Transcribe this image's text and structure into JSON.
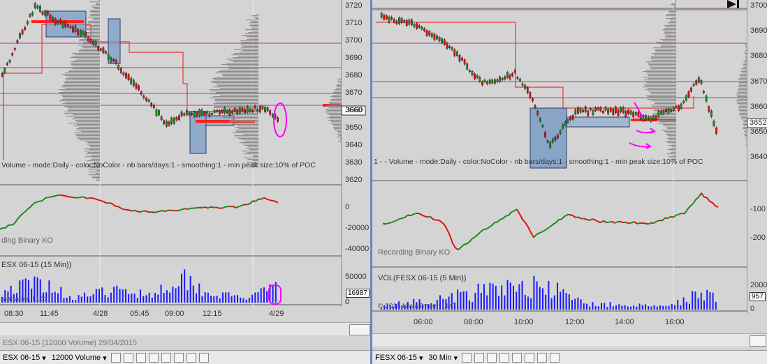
{
  "left": {
    "price_axis": [
      "3720",
      "3710",
      "3700",
      "3690",
      "3680",
      "3670",
      "3660",
      "3650",
      "3640",
      "3630",
      "3620"
    ],
    "last_price": "3660",
    "indicator_label": "Volume - mode:Daily - color:NoColor - nb bars/days:1 - smoothing:1 - min peak size:10% of POC",
    "osc_axis": [
      "0",
      "-20000",
      "-40000"
    ],
    "osc_label": "ding Binary KO",
    "vol_label": "ESX 06-15 (15 Min))",
    "vol_axis": [
      "50000",
      "0"
    ],
    "vol_last": "16987",
    "copyright": "inatrader, LLC",
    "time_axis": [
      "08:30",
      "11:45",
      "4/28",
      "05:45",
      "09:00",
      "12:15",
      "4/29"
    ],
    "toolbar": {
      "instrument": "ESX 06-15",
      "interval": "12000 Volume"
    },
    "caption": "ESX 06-15 (12000 Volume) 29/04/2015"
  },
  "right": {
    "price_axis": [
      "3700",
      "3690",
      "3680",
      "3670",
      "3660",
      "3650",
      "3640"
    ],
    "last_price": "3652",
    "indicator_label": "1 -  - Volume - mode:Daily - color:NoColor - nb bars/days:1 - smoothing:1 - min peak size:10% of POC",
    "osc_axis": [
      "-100",
      "-200"
    ],
    "osc_label": "Recording Binary KO",
    "vol_label": "VOL(FESX 06-15 (5 Min))",
    "vol_axis": [
      "2000",
      "0"
    ],
    "vol_last": "957",
    "copyright": "© 2015 NinjaTrader, LLC",
    "time_axis": [
      "06:00",
      "08:00",
      "10:00",
      "12:00",
      "14:00",
      "16:00"
    ],
    "toolbar": {
      "instrument": "FESX 06-15",
      "interval": "30 Min"
    }
  },
  "colors": {
    "bg": "#d4d4d4",
    "up": "#1a8a1a",
    "down": "#dd1111",
    "accent_red": "#ff2222",
    "magenta": "#ff00ff",
    "volume": "#1a1aff",
    "box": "#7a9cc6"
  }
}
